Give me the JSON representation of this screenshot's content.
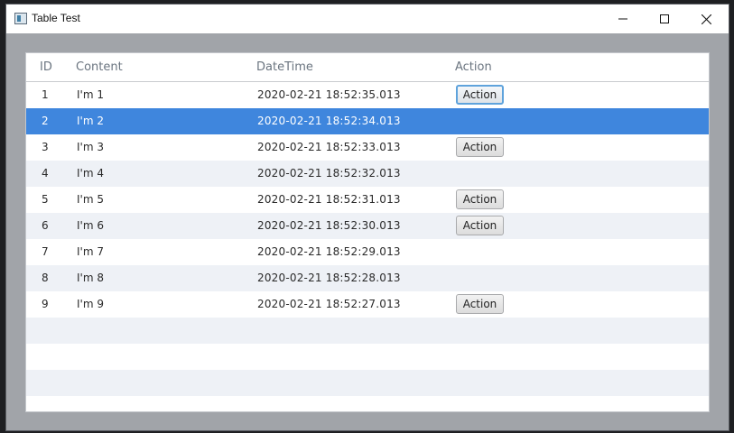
{
  "window": {
    "title": "Table Test"
  },
  "table": {
    "headers": {
      "id": "ID",
      "content": "Content",
      "datetime": "DateTime",
      "action": "Action"
    },
    "action_label": "Action",
    "rows": [
      {
        "id": "1",
        "content": "I'm 1",
        "datetime": "2020-02-21 18:52:35.013",
        "has_action": true,
        "selected": false,
        "focused": true
      },
      {
        "id": "2",
        "content": "I'm 2",
        "datetime": "2020-02-21 18:52:34.013",
        "has_action": false,
        "selected": true,
        "focused": false
      },
      {
        "id": "3",
        "content": "I'm 3",
        "datetime": "2020-02-21 18:52:33.013",
        "has_action": true,
        "selected": false,
        "focused": false
      },
      {
        "id": "4",
        "content": "I'm 4",
        "datetime": "2020-02-21 18:52:32.013",
        "has_action": false,
        "selected": false,
        "focused": false
      },
      {
        "id": "5",
        "content": "I'm 5",
        "datetime": "2020-02-21 18:52:31.013",
        "has_action": true,
        "selected": false,
        "focused": false
      },
      {
        "id": "6",
        "content": "I'm 6",
        "datetime": "2020-02-21 18:52:30.013",
        "has_action": true,
        "selected": false,
        "focused": false
      },
      {
        "id": "7",
        "content": "I'm 7",
        "datetime": "2020-02-21 18:52:29.013",
        "has_action": false,
        "selected": false,
        "focused": false
      },
      {
        "id": "8",
        "content": "I'm 8",
        "datetime": "2020-02-21 18:52:28.013",
        "has_action": false,
        "selected": false,
        "focused": false
      },
      {
        "id": "9",
        "content": "I'm 9",
        "datetime": "2020-02-21 18:52:27.013",
        "has_action": true,
        "selected": false,
        "focused": false
      }
    ],
    "empty_rows": 3
  },
  "icons": {
    "app": "window-app-icon",
    "minimize": "minimize-icon",
    "maximize": "maximize-icon",
    "close": "close-icon"
  },
  "colors": {
    "selected_row": "#3f86dd",
    "alt_row": "#eef1f6",
    "window_background": "#a1a4a9"
  }
}
